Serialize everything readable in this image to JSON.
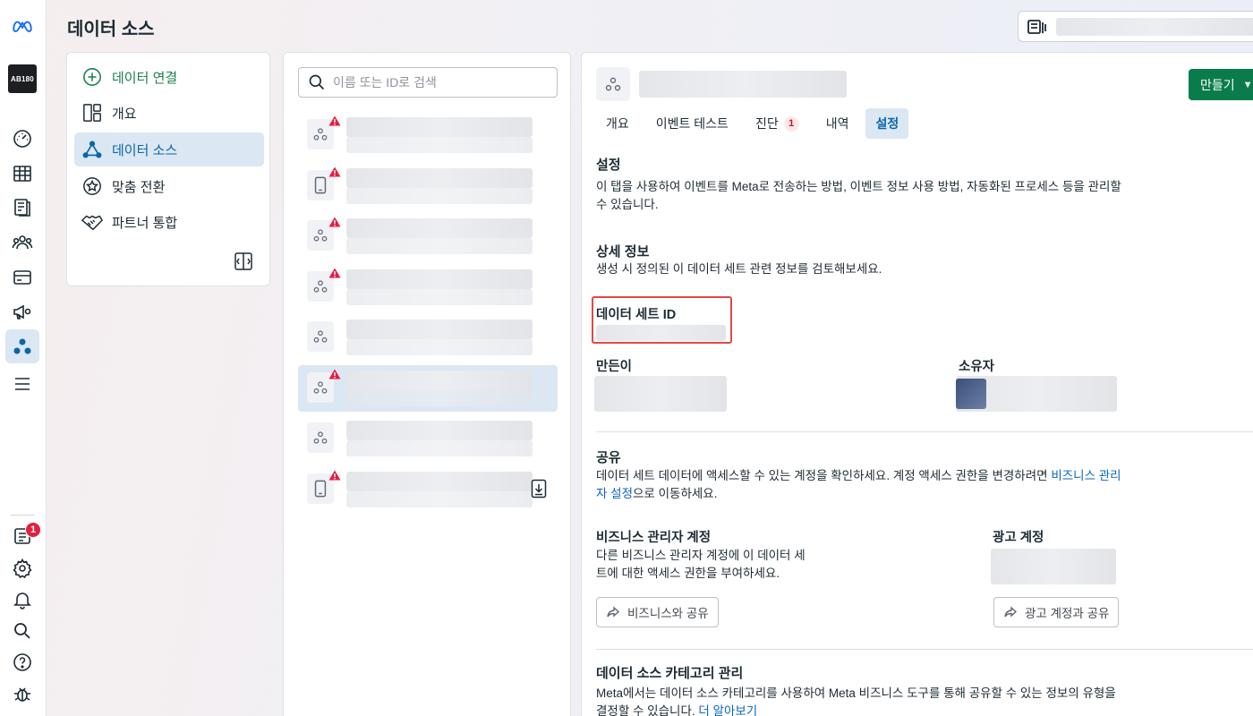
{
  "page": {
    "title": "데이터 소스"
  },
  "rail": {
    "logo_text": "AB180",
    "notification_count": "1"
  },
  "nav": {
    "items": [
      {
        "label": "데이터 연결",
        "icon": "plus-circle-icon"
      },
      {
        "label": "개요",
        "icon": "layout-icon"
      },
      {
        "label": "데이터 소스",
        "icon": "data-source-icon"
      },
      {
        "label": "맞춤 전환",
        "icon": "star-badge-icon"
      },
      {
        "label": "파트너 통합",
        "icon": "handshake-icon"
      }
    ]
  },
  "list": {
    "search_placeholder": "이름 또는 ID로 검색",
    "rows": [
      {
        "type": "data-source",
        "warning": true,
        "selected": false,
        "download": false
      },
      {
        "type": "mobile-app",
        "warning": true,
        "selected": false,
        "download": false
      },
      {
        "type": "data-source",
        "warning": true,
        "selected": false,
        "download": false
      },
      {
        "type": "data-source",
        "warning": true,
        "selected": false,
        "download": false
      },
      {
        "type": "data-source",
        "warning": false,
        "selected": false,
        "download": false
      },
      {
        "type": "data-source",
        "warning": true,
        "selected": true,
        "download": false
      },
      {
        "type": "data-source",
        "warning": false,
        "selected": false,
        "download": false
      },
      {
        "type": "mobile-app",
        "warning": true,
        "selected": false,
        "download": true
      }
    ]
  },
  "detail": {
    "create_label": "만들기",
    "tabs": [
      {
        "label": "개요"
      },
      {
        "label": "이벤트 테스트"
      },
      {
        "label": "진단",
        "badge": "1"
      },
      {
        "label": "내역"
      },
      {
        "label": "설정",
        "active": true
      }
    ],
    "settings_title": "설정",
    "settings_desc": "이 탭을 사용하여 이벤트를 Meta로 전송하는 방법, 이벤트 정보 사용 방법, 자동화된 프로세스 등을 관리할 수 있습니다.",
    "details_title": "상세 정보",
    "details_desc": "생성 시 정의된 이 데이터 세트 관련 정보를 검토해보세요.",
    "dataset_id_label": "데이터 세트 ID",
    "creator_label": "만든이",
    "owner_label": "소유자",
    "sharing_title": "공유",
    "sharing_desc_pre": "데이터 세트 데이터에 액세스할 수 있는 계정을 확인하세요. 계정 액세스 권한을 변경하려면 ",
    "sharing_link": "비즈니스 관리자 설정",
    "sharing_desc_post": "으로 이동하세요.",
    "bm_title": "비즈니스 관리자 계정",
    "bm_desc": "다른 비즈니스 관리자 계정에 이 데이터 세트에 대한 액세스 권한을 부여하세요.",
    "bm_button": "비즈니스와 공유",
    "ad_title": "광고 계정",
    "ad_button": "광고 계정과 공유",
    "category_title": "데이터 소스 카테고리 관리",
    "category_desc": "Meta에서는 데이터 소스 카테고리를 사용하여 Meta 비즈니스 도구를 통해 공유할 수 있는 정보의 유형을 결정할 수 있습니다. ",
    "category_link": "더 알아보기"
  }
}
